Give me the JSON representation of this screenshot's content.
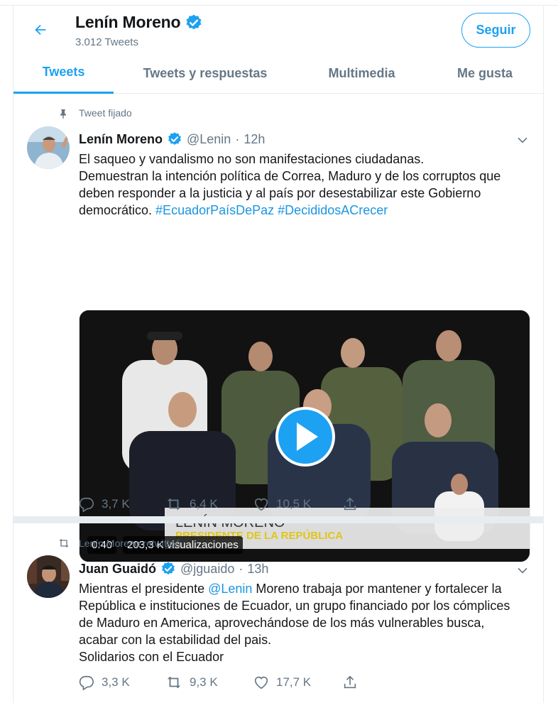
{
  "header": {
    "name": "Lenín Moreno",
    "tweet_count": "3.012 Tweets",
    "follow_label": "Seguir"
  },
  "tabs": [
    {
      "label": "Tweets",
      "active": true
    },
    {
      "label": "Tweets y respuestas",
      "active": false
    },
    {
      "label": "Multimedia",
      "active": false
    },
    {
      "label": "Me gusta",
      "active": false
    }
  ],
  "tweets": [
    {
      "context": "Tweet fijado",
      "context_icon": "pin-icon",
      "name": "Lenín Moreno",
      "verified": true,
      "handle": "@Lenin",
      "separator": "·",
      "time": "12h",
      "text_lines": [
        "El saqueo y vandalismo no son manifestaciones ciudadanas.",
        "Demuestran la intención política de Correa, Maduro y de los corruptos que",
        "deben responder a la  justicia y al país por desestabilizar este Gobierno"
      ],
      "text_last_plain": "democrático. ",
      "hashtags": [
        "#EcuadorPaísDePaz",
        "#DecididosACrecer"
      ],
      "video": {
        "lower_third_name": "LENÍN MORENO",
        "lower_third_title": "PRESIDENTE DE LA REPÚBLICA",
        "duration": "0:40",
        "views": "203,3 K visualizaciones"
      },
      "stats": {
        "replies": "3,7 K",
        "retweets": "6,4 K",
        "likes": "10,5 K"
      }
    },
    {
      "context": "Lenín Moreno retwitteó",
      "context_icon": "retweet-icon",
      "name": "Juan Guaidó",
      "verified": true,
      "handle": "@jguaido",
      "separator": "·",
      "time": "13h",
      "text_first_plain": "Mientras el presidente ",
      "mention": "@Lenin",
      "text_first_rest": " Moreno trabaja por mantener y fortalecer la",
      "text_lines": [
        "República e instituciones de Ecuador, un grupo financiado por los cómplices",
        "de Maduro en America, aprovechándose de los más vulnerables busca,",
        "acabar con la estabilidad del pais.",
        "Solidarios con el Ecuador"
      ],
      "stats": {
        "replies": "3,3 K",
        "retweets": "9,3 K",
        "likes": "17,7 K"
      }
    }
  ],
  "colors": {
    "accent": "#1da1f2",
    "link": "#1b95e0",
    "muted": "#657786",
    "divider": "#e6ecf0"
  }
}
